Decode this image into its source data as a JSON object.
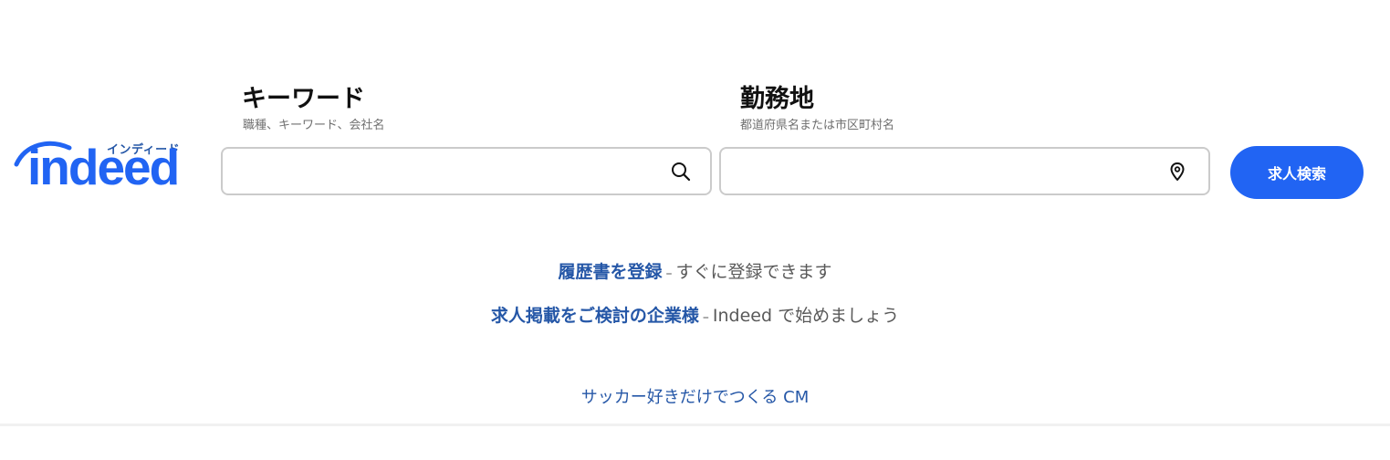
{
  "logo": {
    "kana": "インディード",
    "word": "indeed"
  },
  "what": {
    "label": "キーワード",
    "sublabel": "職種、キーワード、会社名",
    "value": "",
    "icon": "search-icon"
  },
  "where": {
    "label": "勤務地",
    "sublabel": "都道府県名または市区町村名",
    "value": "",
    "icon": "map-pin-icon"
  },
  "search_button": {
    "label": "求人検索"
  },
  "promos": {
    "resume": {
      "link": "履歴書を登録",
      "dash": "–",
      "text": "すぐに登録できます"
    },
    "employer": {
      "link": "求人掲載をご検討の企業様",
      "dash": "–",
      "text": "Indeed で始めましょう"
    }
  },
  "cm_link": "サッカー好きだけでつくる CM",
  "colors": {
    "brand_blue": "#2164f3",
    "link_blue": "#2557a7",
    "border_gray": "#cbcbcb"
  }
}
